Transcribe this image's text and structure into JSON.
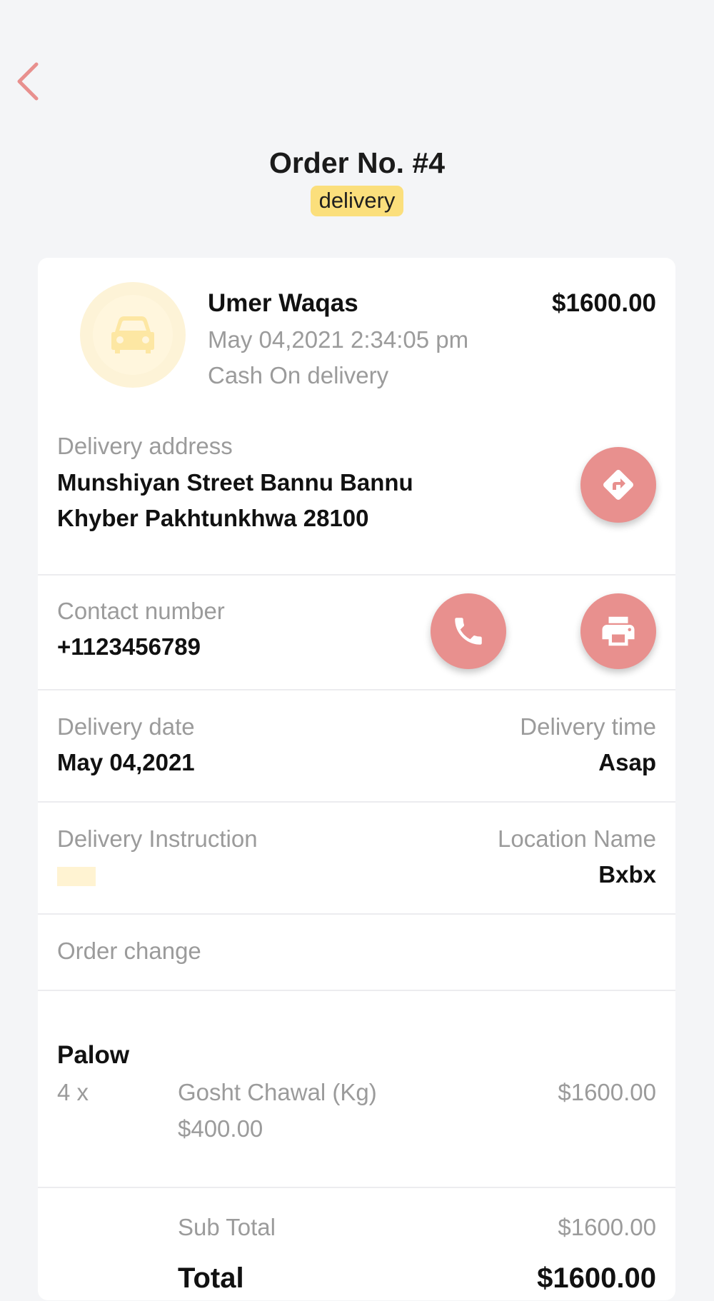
{
  "header": {
    "title": "Order No. #4",
    "order_type_badge": "delivery"
  },
  "order": {
    "customer_name": "Umer Waqas",
    "amount": "$1600.00",
    "datetime": "May 04,2021 2:34:05 pm",
    "payment_method": "Cash On delivery"
  },
  "address": {
    "label": "Delivery address",
    "line1": "Munshiyan Street Bannu Bannu",
    "line2": "Khyber Pakhtunkhwa 28100"
  },
  "contact": {
    "label": "Contact number",
    "value": "+1123456789"
  },
  "schedule": {
    "date_label": "Delivery date",
    "date_value": "May 04,2021",
    "time_label": "Delivery time",
    "time_value": "Asap"
  },
  "instruction": {
    "label": "Delivery Instruction",
    "location_label": "Location Name",
    "location_value": "Bxbx"
  },
  "order_change": {
    "label": "Order change"
  },
  "items": [
    {
      "category": "Palow",
      "quantity": "4 x",
      "name": "Gosht Chawal (Kg)",
      "line_total": "$1600.00",
      "unit_price": "$400.00"
    }
  ],
  "totals": {
    "subtotal_label": "Sub Total",
    "subtotal_value": "$1600.00",
    "total_label": "Total",
    "total_value": "$1600.00"
  },
  "icons": {
    "back": "chevron-left-icon",
    "avatar": "car-icon",
    "directions": "directions-icon",
    "call": "phone-icon",
    "print": "printer-icon"
  },
  "colors": {
    "accent": "#e8908e",
    "badge": "#fbdf7c",
    "avatar_ring": "#fdf3d7",
    "background": "#f4f5f7"
  }
}
